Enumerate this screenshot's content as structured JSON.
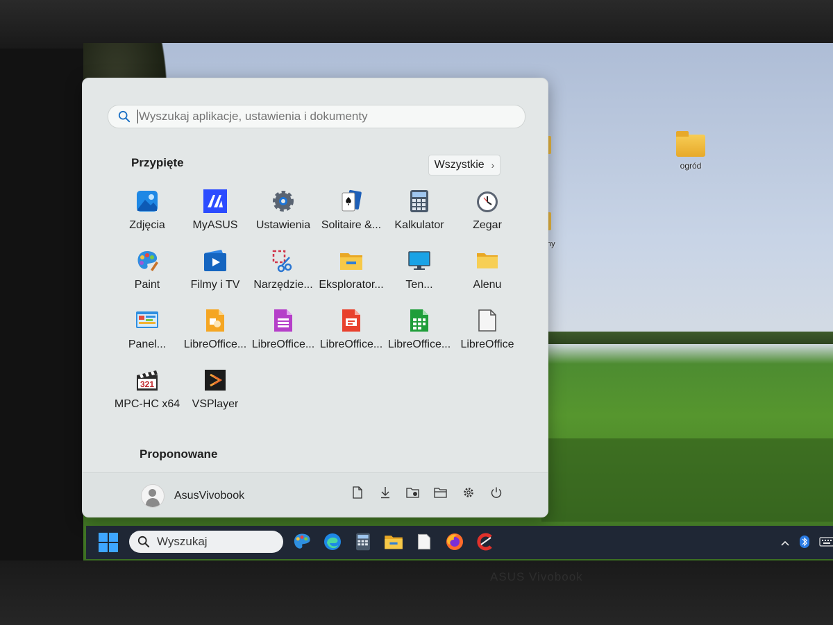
{
  "desktop": {
    "icons": [
      {
        "label": "ogród"
      },
      {
        "label": "ny"
      }
    ]
  },
  "start_menu": {
    "search": {
      "placeholder": "Wyszukaj aplikacje, ustawienia i dokumenty"
    },
    "pinned": {
      "title": "Przypięte",
      "all_label": "Wszystkie",
      "apps": [
        {
          "label": "Zdjęcia",
          "icon": "photos-icon"
        },
        {
          "label": "MyASUS",
          "icon": "myasus-icon"
        },
        {
          "label": "Ustawienia",
          "icon": "gear-icon"
        },
        {
          "label": "Solitaire &...",
          "icon": "cards-icon"
        },
        {
          "label": "Kalkulator",
          "icon": "calculator-icon"
        },
        {
          "label": "Zegar",
          "icon": "clock-icon"
        },
        {
          "label": "Paint",
          "icon": "palette-icon"
        },
        {
          "label": "Filmy i TV",
          "icon": "play-icon"
        },
        {
          "label": "Narzędzie...",
          "icon": "snipping-tool-icon"
        },
        {
          "label": "Eksplorator...",
          "icon": "folder-icon"
        },
        {
          "label": "Ten...",
          "icon": "monitor-icon"
        },
        {
          "label": "Alenu",
          "icon": "folder-icon"
        },
        {
          "label": "Panel...",
          "icon": "control-panel-icon"
        },
        {
          "label": "LibreOffice...",
          "icon": "libreoffice-draw-icon"
        },
        {
          "label": "LibreOffice...",
          "icon": "libreoffice-base-icon"
        },
        {
          "label": "LibreOffice...",
          "icon": "libreoffice-impress-icon"
        },
        {
          "label": "LibreOffice...",
          "icon": "libreoffice-calc-icon"
        },
        {
          "label": "LibreOffice",
          "icon": "libreoffice-icon"
        },
        {
          "label": "MPC-HC x64",
          "icon": "media-player-icon"
        },
        {
          "label": "VSPlayer",
          "icon": "vsplayer-icon"
        }
      ]
    },
    "suggested": {
      "title": "Proponowane"
    },
    "footer": {
      "user_name": "AsusVivobook",
      "buttons": [
        "document-icon",
        "download-icon",
        "network-folder-icon",
        "folder-open-icon",
        "gear-icon",
        "power-icon"
      ]
    }
  },
  "taskbar": {
    "search_label": "Wyszukaj",
    "apps": [
      "paint-icon",
      "edge-icon",
      "calculator-icon",
      "file-explorer-icon",
      "libreoffice-icon",
      "firefox-icon",
      "ccleaner-icon"
    ],
    "tray": [
      "chevron-up-icon",
      "bluetooth-icon",
      "keyboard-icon"
    ]
  },
  "device": {
    "brand_label": "ASUS Vivobook"
  }
}
